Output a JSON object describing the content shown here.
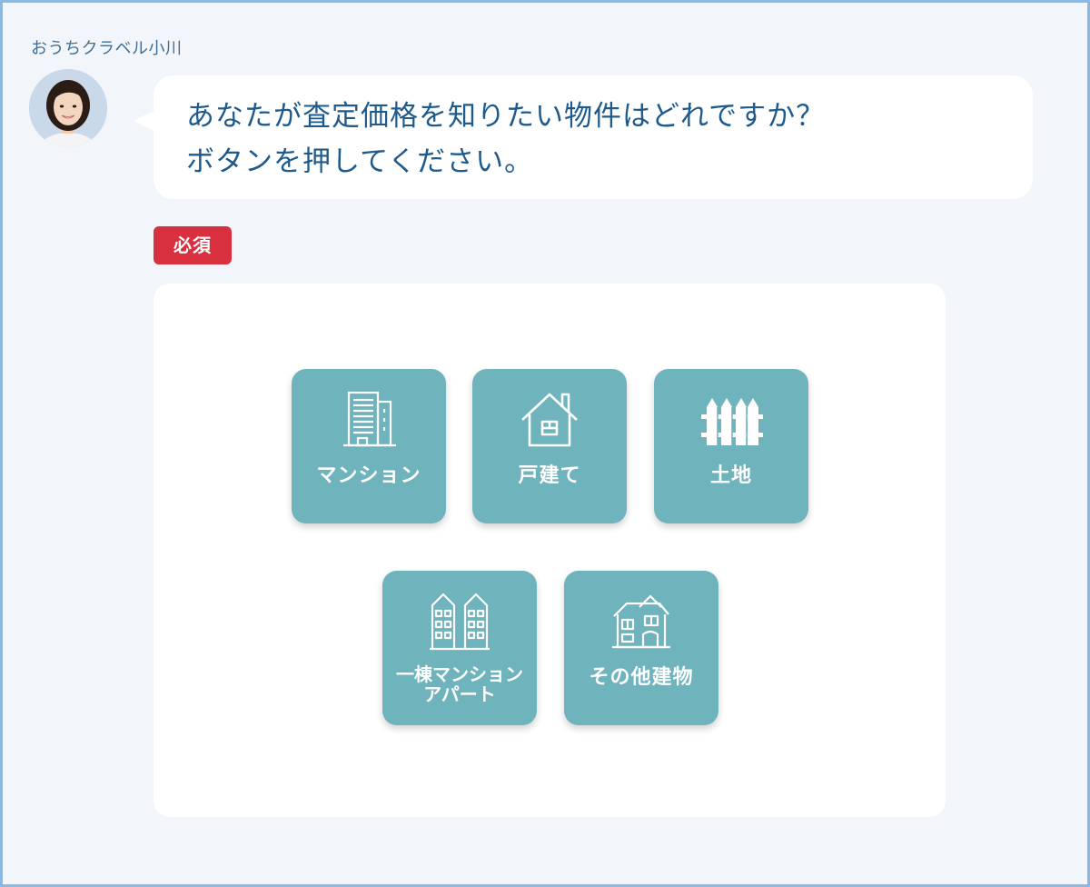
{
  "agent": {
    "name": "おうちクラベル小川"
  },
  "message": {
    "line1": "あなたが査定価格を知りたい物件はどれですか？",
    "line2": "ボタンを押してください。"
  },
  "required_badge": "必須",
  "options": [
    {
      "label": "マンション",
      "icon": "apartment-building-icon"
    },
    {
      "label": "戸建て",
      "icon": "house-icon"
    },
    {
      "label": "土地",
      "icon": "fence-icon"
    },
    {
      "label_line1": "一棟マンション",
      "label_line2": "アパート",
      "icon": "twin-apartment-icon"
    },
    {
      "label": "その他建物",
      "icon": "other-building-icon"
    }
  ],
  "colors": {
    "frame_border": "#8db7dc",
    "background": "#f2f6fa",
    "message_text": "#1e5a8c",
    "required": "#d9303f",
    "option_card": "#6fb3bd"
  }
}
